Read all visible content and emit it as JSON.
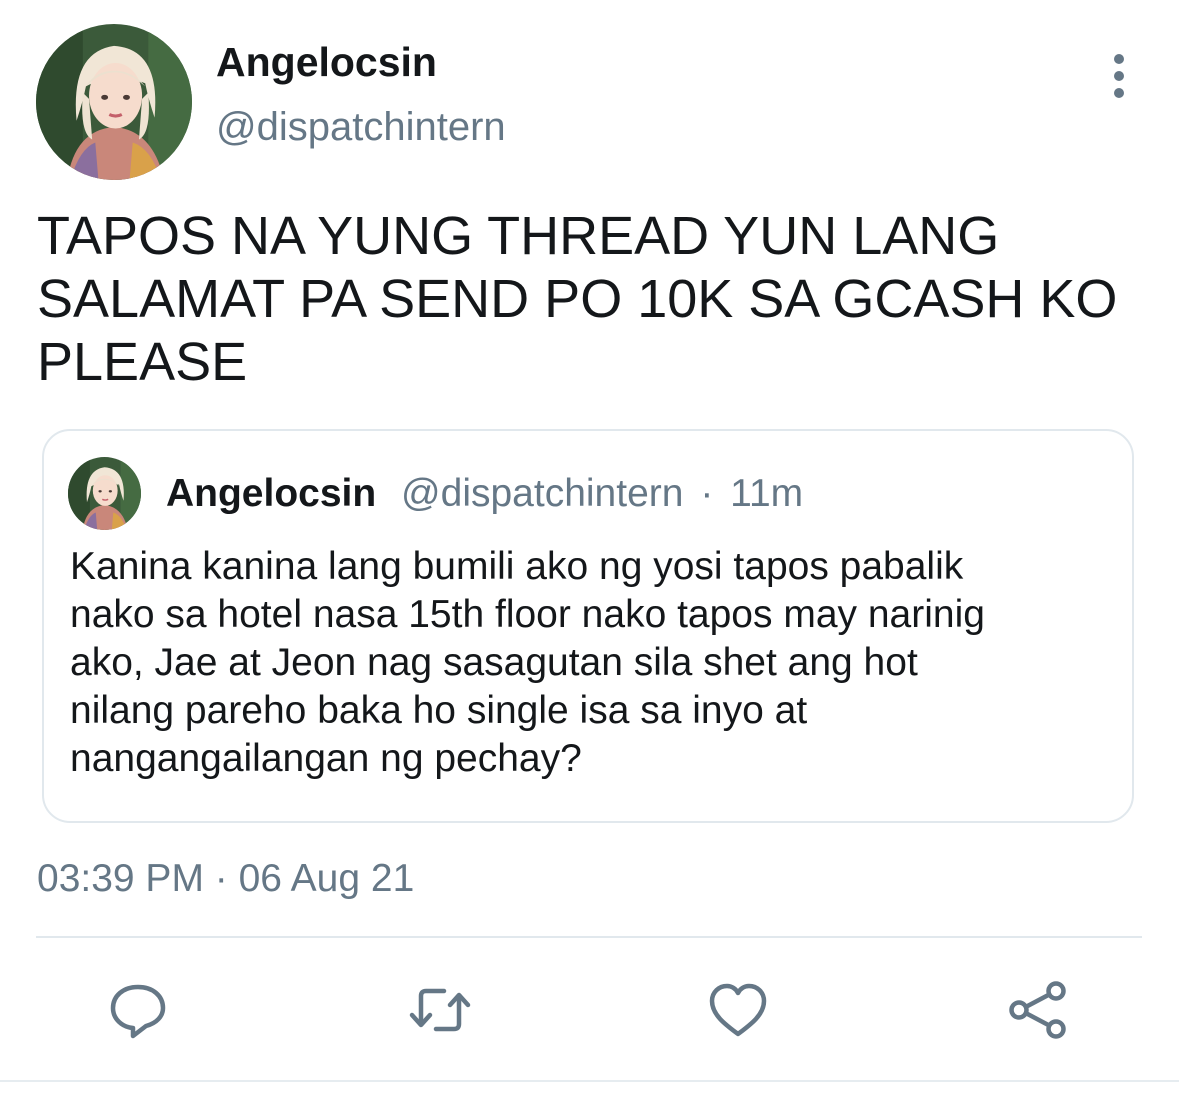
{
  "tweet": {
    "display_name": "Angelocsin",
    "handle": "@dispatchintern",
    "avatar_icon": "profile-photo",
    "more_icon": "more-vertical-icon",
    "text_lines": [
      "TAPOS NA YUNG THREAD YUN LANG",
      "SALAMAT PA SEND PO 10K SA GCASH KO",
      "PLEASE"
    ],
    "timestamp": "03:39 PM · 06 Aug 21"
  },
  "quote": {
    "display_name": "Angelocsin",
    "handle": "@dispatchintern",
    "separator": "·",
    "time": "11m",
    "body_lines": [
      "Kanina kanina lang bumili ako ng yosi tapos pabalik",
      "nako sa hotel nasa 15th floor nako tapos may narinig",
      "ako, Jae at Jeon nag sasagutan sila shet ang hot",
      "nilang pareho baka ho single isa sa inyo at",
      "nangangailangan ng pechay?"
    ]
  },
  "actions": [
    {
      "icon": "reply-icon"
    },
    {
      "icon": "retweet-icon"
    },
    {
      "icon": "like-icon"
    },
    {
      "icon": "share-icon"
    }
  ],
  "colors": {
    "text_primary": "#14171a",
    "text_secondary": "#657786",
    "border": "#e1e8ed"
  }
}
